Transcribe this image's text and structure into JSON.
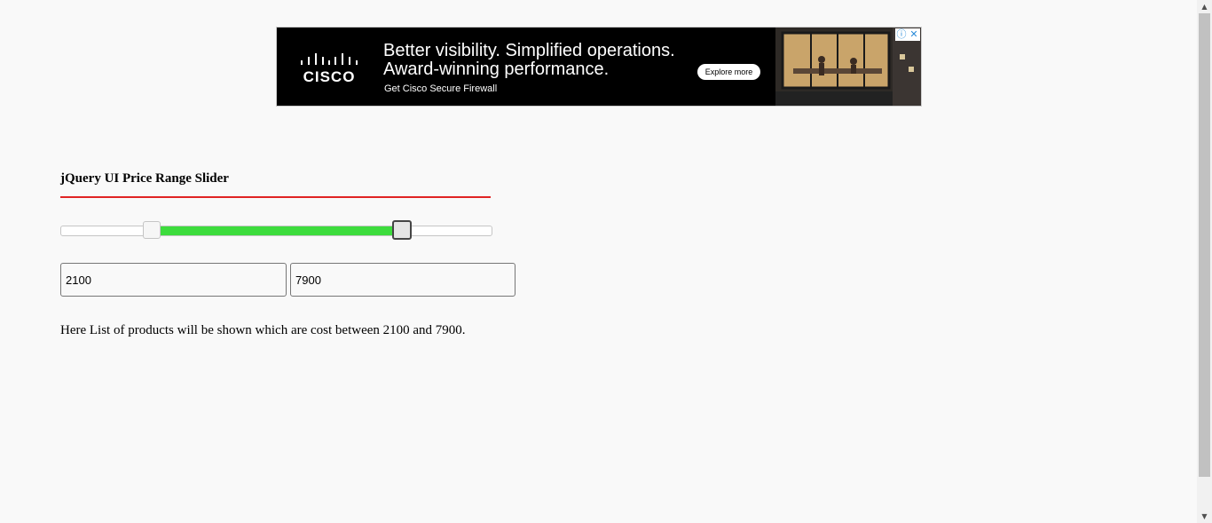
{
  "ad": {
    "logo_text": "CISCO",
    "headline_line1": "Better visibility. Simplified operations.",
    "headline_line2": "Award-winning performance.",
    "subline": "Get Cisco Secure Firewall",
    "cta_label": "Explore more",
    "info_icon": "ⓘ",
    "close_icon": "✕"
  },
  "page": {
    "title": "jQuery UI Price Range Slider"
  },
  "slider": {
    "min": 0,
    "max": 10000,
    "low": 2100,
    "high": 7900,
    "range_color": "#3ddc3d"
  },
  "inputs": {
    "min_value": "2100",
    "max_value": "7900"
  },
  "result": {
    "text": "Here List of products will be shown which are cost between 2100 and 7900."
  },
  "scrollbar": {
    "up_icon": "▲",
    "down_icon": "▼"
  }
}
